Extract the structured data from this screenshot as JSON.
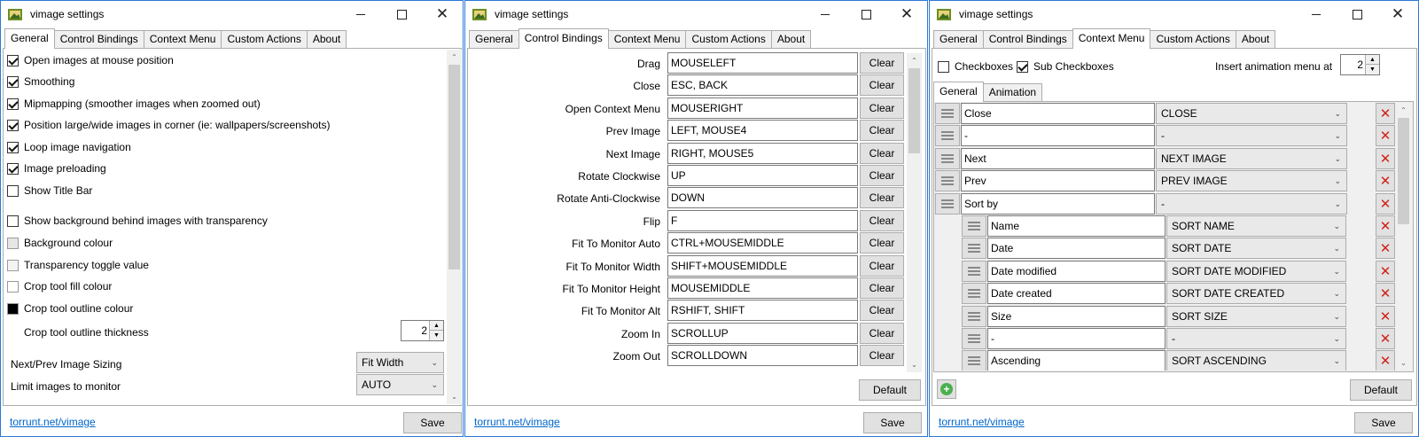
{
  "windows": [
    {
      "title": "vimage settings",
      "tabs": [
        "General",
        "Control Bindings",
        "Context Menu",
        "Custom Actions",
        "About"
      ],
      "active_tab": "General",
      "footer_link": "torrunt.net/vimage",
      "save_label": "Save",
      "general": {
        "options": [
          {
            "label": "Open images at mouse position",
            "checked": true
          },
          {
            "label": "Smoothing",
            "checked": true
          },
          {
            "label": "Mipmapping (smoother images when zoomed out)",
            "checked": true
          },
          {
            "label": "Position large/wide images in corner (ie: wallpapers/screenshots)",
            "checked": true
          },
          {
            "label": "Loop image navigation",
            "checked": true
          },
          {
            "label": "Image preloading",
            "checked": true
          },
          {
            "label": "Show Title Bar",
            "checked": false
          },
          {
            "label": "Show background behind images with transparency",
            "checked": false
          }
        ],
        "colours": [
          {
            "label": "Background colour",
            "color": "#e6e6e6"
          },
          {
            "label": "Transparency toggle value",
            "color": "#f4f4f4"
          },
          {
            "label": "Crop tool fill colour",
            "color": "#ffffff"
          },
          {
            "label": "Crop tool outline colour",
            "color": "#000000"
          }
        ],
        "outline_thickness_label": "Crop tool outline thickness",
        "outline_thickness_value": "2",
        "next_prev_sizing_label": "Next/Prev Image Sizing",
        "next_prev_sizing_value": "Fit Width",
        "limit_images_label": "Limit images to monitor",
        "limit_images_value": "AUTO"
      }
    },
    {
      "title": "vimage settings",
      "tabs": [
        "General",
        "Control Bindings",
        "Context Menu",
        "Custom Actions",
        "About"
      ],
      "active_tab": "Control Bindings",
      "footer_link": "torrunt.net/vimage",
      "save_label": "Save",
      "clear_label": "Clear",
      "default_label": "Default",
      "bindings": [
        {
          "label": "Drag",
          "value": "MOUSELEFT"
        },
        {
          "label": "Close",
          "value": "ESC, BACK"
        },
        {
          "label": "Open Context Menu",
          "value": "MOUSERIGHT"
        },
        {
          "label": "Prev Image",
          "value": "LEFT, MOUSE4"
        },
        {
          "label": "Next Image",
          "value": "RIGHT, MOUSE5"
        },
        {
          "label": "Rotate Clockwise",
          "value": "UP"
        },
        {
          "label": "Rotate Anti-Clockwise",
          "value": "DOWN"
        },
        {
          "label": "Flip",
          "value": "F"
        },
        {
          "label": "Fit To Monitor Auto",
          "value": "CTRL+MOUSEMIDDLE"
        },
        {
          "label": "Fit To Monitor Width",
          "value": "SHIFT+MOUSEMIDDLE"
        },
        {
          "label": "Fit To Monitor Height",
          "value": "MOUSEMIDDLE"
        },
        {
          "label": "Fit To Monitor Alt",
          "value": "RSHIFT, SHIFT"
        },
        {
          "label": "Zoom In",
          "value": "SCROLLUP"
        },
        {
          "label": "Zoom Out",
          "value": "SCROLLDOWN"
        }
      ]
    },
    {
      "title": "vimage settings",
      "tabs": [
        "General",
        "Control Bindings",
        "Context Menu",
        "Custom Actions",
        "About"
      ],
      "active_tab": "Context Menu",
      "footer_link": "torrunt.net/vimage",
      "save_label": "Save",
      "default_label": "Default",
      "checkboxes_label": "Checkboxes",
      "checkboxes_checked": false,
      "sub_checkboxes_label": "Sub Checkboxes",
      "sub_checkboxes_checked": true,
      "insert_anim_label": "Insert animation menu at",
      "insert_anim_value": "2",
      "subtabs": [
        "General",
        "Animation"
      ],
      "active_subtab": "General",
      "items": [
        {
          "name": "Close",
          "func": "CLOSE",
          "level": 0
        },
        {
          "name": "-",
          "func": "-",
          "level": 0
        },
        {
          "name": "Next",
          "func": "NEXT IMAGE",
          "level": 0
        },
        {
          "name": "Prev",
          "func": "PREV IMAGE",
          "level": 0
        },
        {
          "name": "Sort by",
          "func": "-",
          "level": 0
        },
        {
          "name": "Name",
          "func": "SORT NAME",
          "level": 1
        },
        {
          "name": "Date",
          "func": "SORT DATE",
          "level": 1
        },
        {
          "name": "Date modified",
          "func": "SORT DATE MODIFIED",
          "level": 1
        },
        {
          "name": "Date created",
          "func": "SORT DATE CREATED",
          "level": 1
        },
        {
          "name": "Size",
          "func": "SORT SIZE",
          "level": 1
        },
        {
          "name": "-",
          "func": "-",
          "level": 1
        },
        {
          "name": "Ascending",
          "func": "SORT ASCENDING",
          "level": 1
        }
      ]
    }
  ]
}
